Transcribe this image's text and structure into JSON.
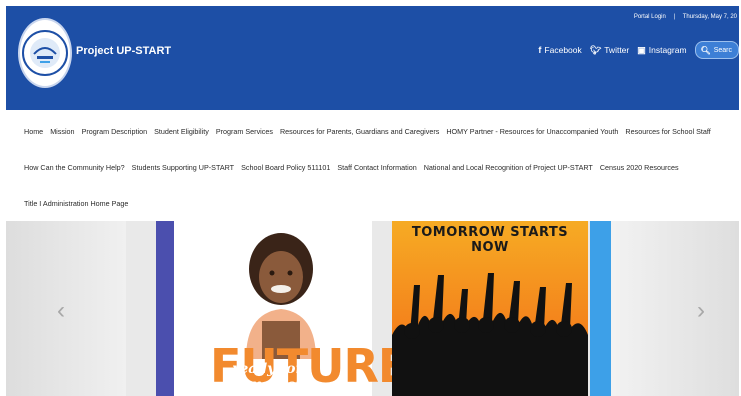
{
  "header": {
    "title": "Project UP-START",
    "top_links": [
      "Portal Login",
      "|",
      "Thursday, May 7, 20"
    ],
    "social": [
      {
        "icon": "facebook-icon",
        "label": "Facebook"
      },
      {
        "icon": "twitter-icon",
        "label": "Twitter"
      },
      {
        "icon": "instagram-icon",
        "label": "Instagram"
      }
    ],
    "search_label": "Searc",
    "colors": {
      "band": "#1d4fa6"
    }
  },
  "nav": {
    "row1": [
      "Home",
      "Mission",
      "Program Description",
      "Student Eligibility",
      "Program Services",
      "Resources for Parents, Guardians and Caregivers",
      "HOMY Partner - Resources for Unaccompanied Youth",
      "Resources for School Staff"
    ],
    "row2": [
      "How Can the Community Help?",
      "Students Supporting UP-START",
      "School Board Policy 511101",
      "Staff Contact Information",
      "National and Local Recognition of Project UP-START",
      "Census 2020 Resources"
    ],
    "row3": [
      "Title I Administration Home Page"
    ]
  },
  "carousel": {
    "slide1_word": "FUTURE",
    "slide1_caption": "ready for tomorrow",
    "slide2_banner": "TOMORROW STARTS NOW",
    "prev_icon": "chevron-left-icon",
    "next_icon": "chevron-right-icon"
  }
}
